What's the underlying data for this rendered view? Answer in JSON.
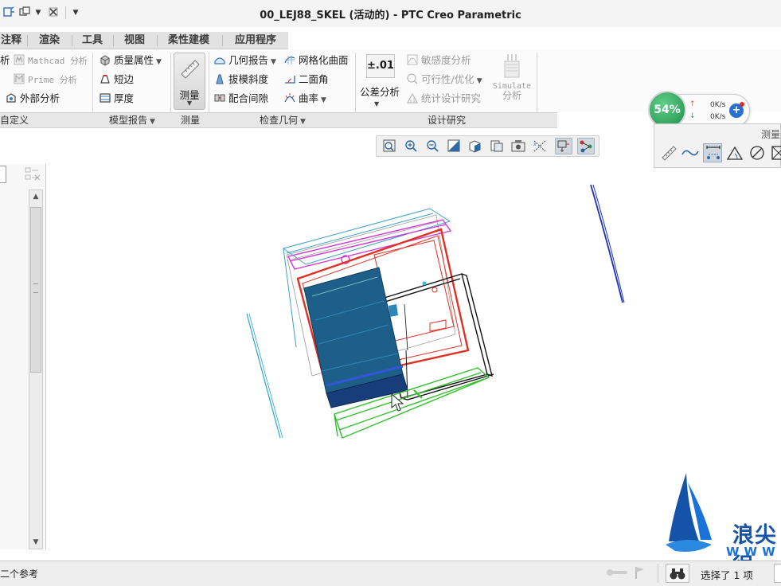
{
  "window": {
    "title": "00_LEJ88_SKEL (活动的) - PTC Creo Parametric"
  },
  "tabs": [
    "注释",
    "渲染",
    "工具",
    "视图",
    "柔性建模",
    "应用程序"
  ],
  "ribbon": {
    "custom": {
      "item1": "析",
      "item2": "义"
    },
    "mathcad": "Mathcad 分析",
    "prime": "Prime 分析",
    "external": "外部分析",
    "mass_props": "质量属性",
    "short_edge": "短边",
    "thickness": "厚度",
    "measure": "测量",
    "geom_report": "几何报告",
    "draft": "拔模斜度",
    "clearance": "配合间隙",
    "mesh_surface": "网格化曲面",
    "dihedral": "二面角",
    "curvature": "曲率",
    "tolerance": {
      "icon_text": "±.01",
      "label": "公差分析"
    },
    "sensitivity": "敏感度分析",
    "feasibility": "可行性/优化",
    "stat_design": "统计设计研究",
    "simulate": {
      "line1": "Simulate",
      "line2": "分析"
    }
  },
  "groups": {
    "custom": "自定义",
    "model_report": "模型报告",
    "measure": "测量",
    "inspect_geometry": "检查几何",
    "design_study": "设计研究"
  },
  "net_widget": {
    "percent": "54%",
    "up": "0K/s",
    "down": "0K/s"
  },
  "measure_toolbar": {
    "title": "测量"
  },
  "status": {
    "message": "二个参考",
    "selected": "选择了 1 项"
  },
  "watermark": {
    "text": "浪尖很",
    "www": "WWW"
  },
  "colors": {
    "body_blue": "#1e5f8a",
    "red_sketch": "#e03024",
    "green_sketch": "#2fc02a",
    "magenta_sketch": "#d23bd6",
    "cyan_sketch": "#28a6c6",
    "dark_blue": "#1d34b8",
    "accent_green": "#2f9e56"
  }
}
